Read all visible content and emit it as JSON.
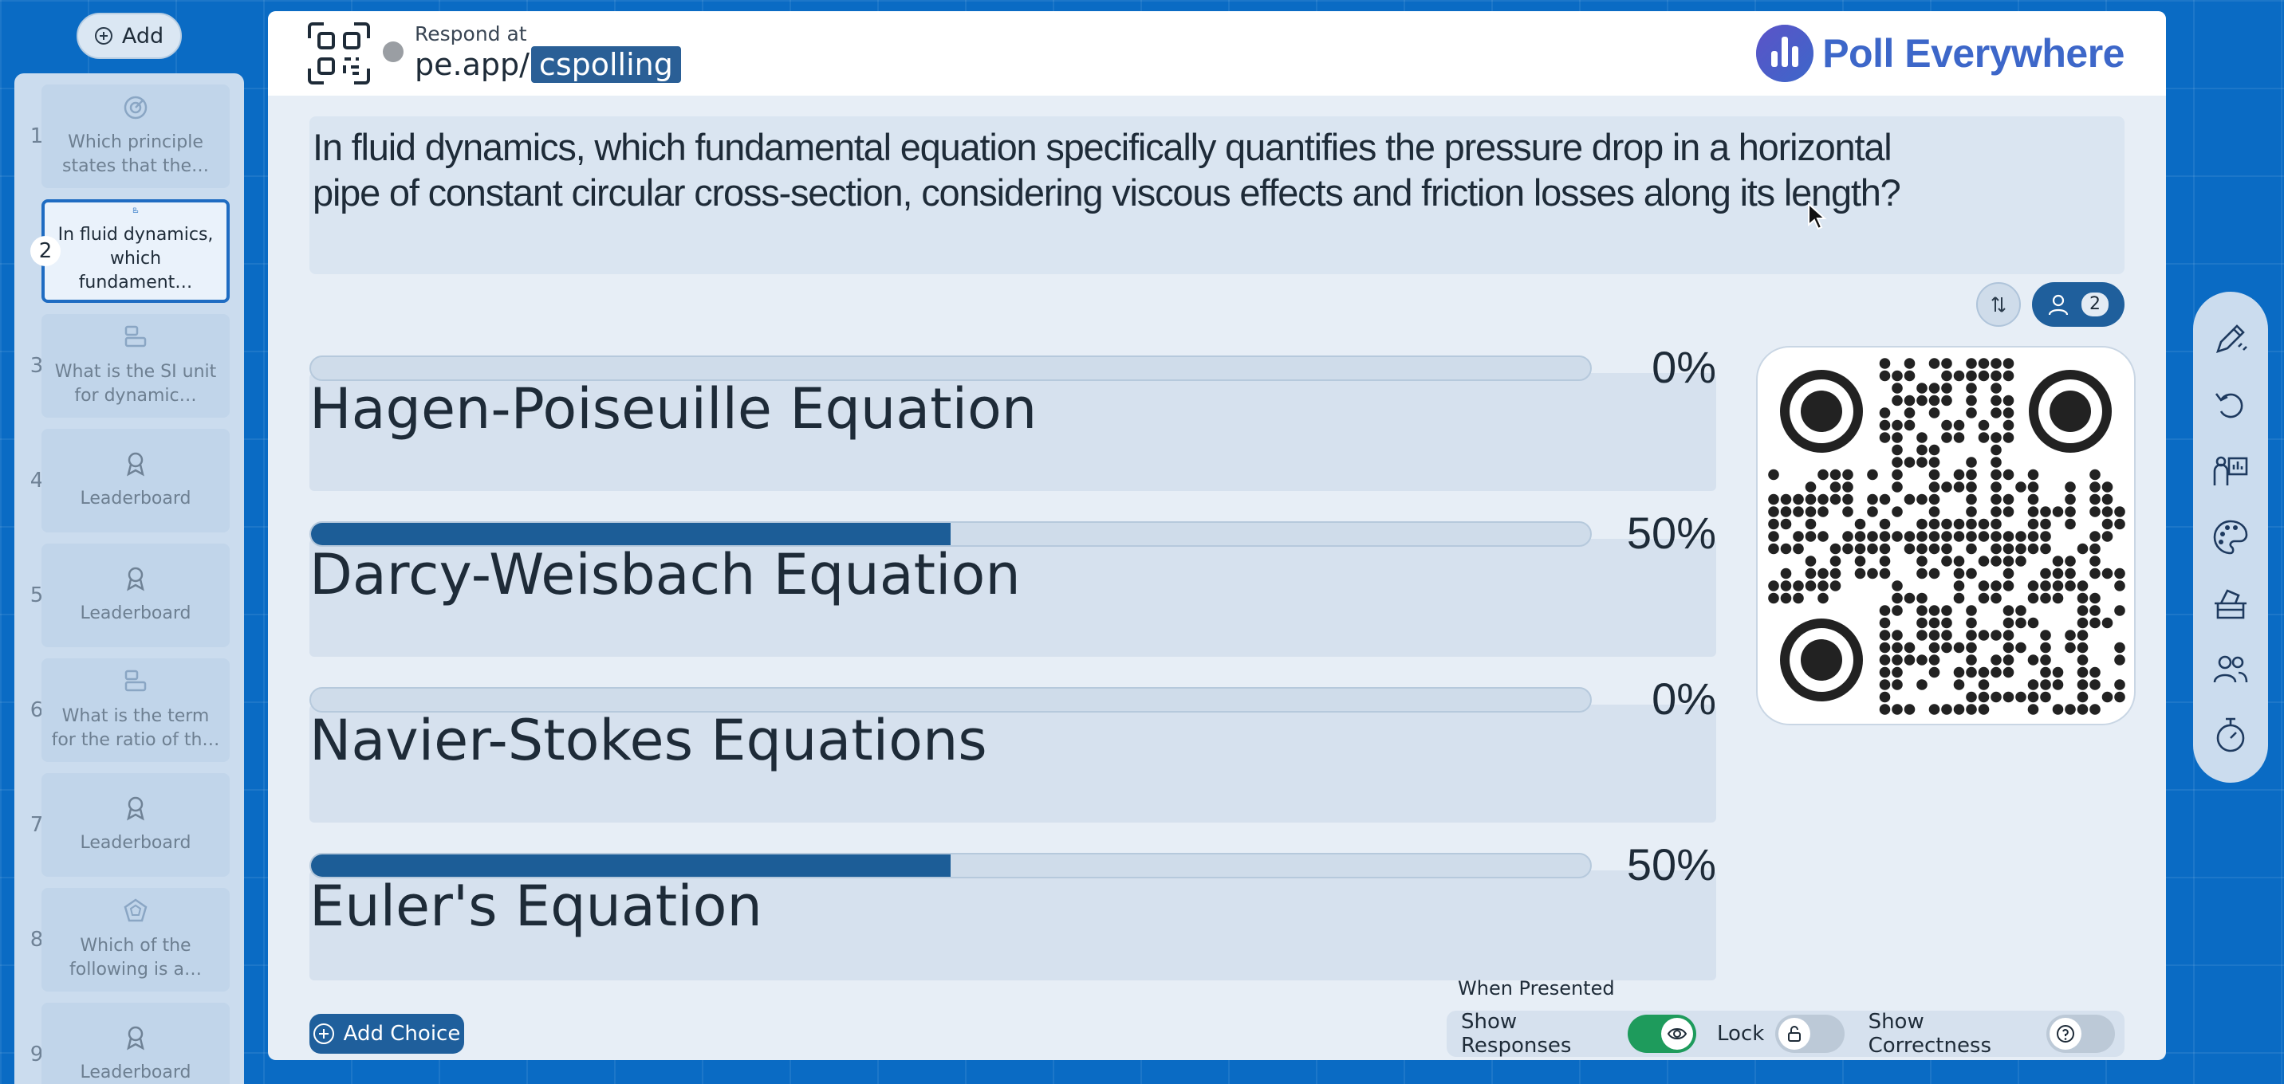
{
  "toolbar": {
    "add_label": "Add"
  },
  "sidebar": {
    "slides": [
      {
        "num": "1",
        "title": "Which principle states that the…",
        "icon": "target-icon"
      },
      {
        "num": "2",
        "title": "In fluid dynamics, which fundament…",
        "icon": "bar-chart-icon"
      },
      {
        "num": "3",
        "title": "What is the SI unit for dynamic…",
        "icon": "bar-chart-icon"
      },
      {
        "num": "4",
        "title": "Leaderboard",
        "icon": "award-icon"
      },
      {
        "num": "5",
        "title": "Leaderboard",
        "icon": "award-icon"
      },
      {
        "num": "6",
        "title": "What is the term for the ratio of th…",
        "icon": "bar-chart-icon"
      },
      {
        "num": "7",
        "title": "Leaderboard",
        "icon": "award-icon"
      },
      {
        "num": "8",
        "title": "Which of the following is a…",
        "icon": "competition-icon"
      },
      {
        "num": "9",
        "title": "Leaderboard",
        "icon": "award-icon"
      }
    ]
  },
  "header": {
    "respond_at": "Respond at",
    "url_prefix": "pe.app/",
    "url_code": "cspolling",
    "brand": "Poll Everywhere",
    "brand_color": "#3d67c9"
  },
  "question": {
    "line1": "In fluid dynamics, which fundamental equation specifically quantifies the pressure drop in a horizontal",
    "line2": "pipe of constant circular cross-section, considering viscous effects and friction losses along its length?"
  },
  "responses": {
    "count": "2"
  },
  "choices": [
    {
      "label": "Hagen-Poiseuille Equation",
      "percent_text": "0%",
      "fraction": 0.0
    },
    {
      "label": "Darcy-Weisbach Equation",
      "percent_text": "50%",
      "fraction": 0.5
    },
    {
      "label": "Navier-Stokes Equations",
      "percent_text": "0%",
      "fraction": 0.0
    },
    {
      "label": "Euler's Equation",
      "percent_text": "50%",
      "fraction": 0.5
    }
  ],
  "footer": {
    "add_choice": "Add Choice",
    "when_presented": "When Presented",
    "show_responses": "Show Responses",
    "show_responses_on": true,
    "lock": "Lock",
    "lock_on": false,
    "show_correctness": "Show Correctness",
    "show_correctness_on": false
  },
  "colors": {
    "accent": "#1f5f9c",
    "bar_fill": "#1c5d97",
    "toggle_on": "#1e9b5c",
    "background": "#0a6bc4"
  },
  "rightbar": {
    "icons": [
      "pen-icon",
      "reset-icon",
      "presenter-icon",
      "palette-icon",
      "voting-booth-icon",
      "participants-icon",
      "timer-icon"
    ]
  }
}
